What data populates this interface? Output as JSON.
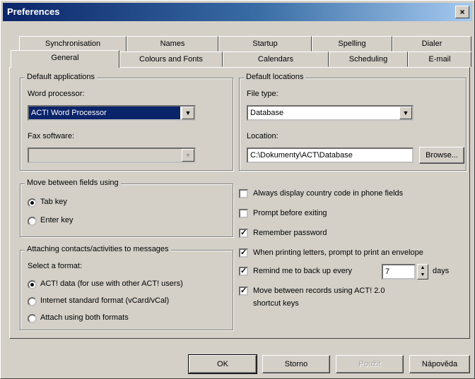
{
  "window": {
    "title": "Preferences",
    "close_glyph": "×"
  },
  "tabs_back": [
    "Synchronisation",
    "Names",
    "Startup",
    "Spelling",
    "Dialer"
  ],
  "tabs_front": [
    "General",
    "Colours and Fonts",
    "Calendars",
    "Scheduling",
    "E-mail"
  ],
  "default_applications": {
    "legend": "Default applications",
    "word_label": "Word processor:",
    "word_value": "ACT! Word Processor",
    "fax_label": "Fax software:",
    "fax_value": ""
  },
  "default_locations": {
    "legend": "Default locations",
    "file_type_label": "File type:",
    "file_type_value": "Database",
    "location_label": "Location:",
    "location_value": "C:\\Dokumenty\\ACT\\Database",
    "browse_label": "Browse..."
  },
  "move_between": {
    "legend": "Move between fields using",
    "options": [
      {
        "label": "Tab key",
        "checked": true
      },
      {
        "label": "Enter key",
        "checked": false
      }
    ]
  },
  "attaching": {
    "legend": "Attaching contacts/activities to messages",
    "select_label": "Select a format:",
    "options": [
      {
        "label": "ACT! data (for use with other ACT! users)",
        "checked": true
      },
      {
        "label": "Internet standard format (vCard/vCal)",
        "checked": false
      },
      {
        "label": "Attach using both formats",
        "checked": false
      }
    ]
  },
  "checkboxes": [
    {
      "label": "Always display country code in phone fields",
      "checked": false
    },
    {
      "label": "Prompt before exiting",
      "checked": false
    },
    {
      "label": "Remember password",
      "checked": true
    },
    {
      "label": "When printing letters, prompt to print an envelope",
      "checked": true
    },
    {
      "label": "Remind me to back up every",
      "checked": true
    },
    {
      "label": "Move between records using ACT! 2.0",
      "label2": "shortcut keys",
      "checked": true
    }
  ],
  "backup": {
    "value": "7",
    "unit": "days"
  },
  "buttons": {
    "ok": "OK",
    "cancel": "Storno",
    "apply": "Použít",
    "help": "Nápověda"
  }
}
